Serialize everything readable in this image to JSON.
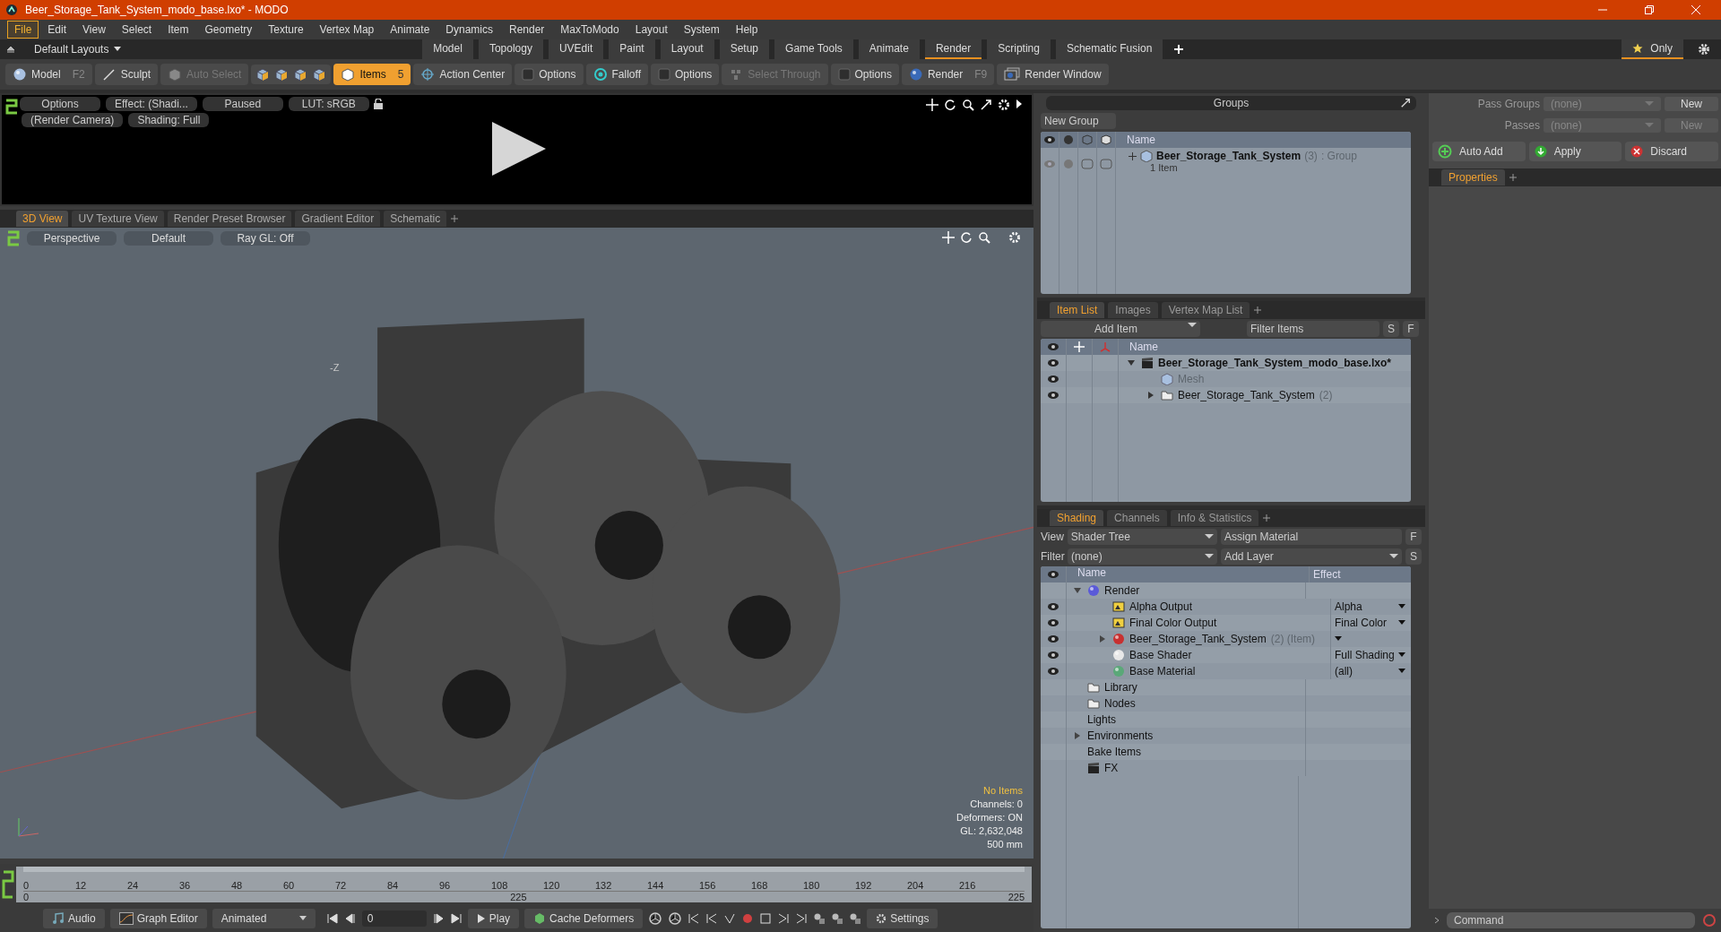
{
  "window": {
    "title": "Beer_Storage_Tank_System_modo_base.lxo* - MODO"
  },
  "menu": [
    {
      "label": "File",
      "selected": true
    },
    {
      "label": "Edit",
      "selected": false
    },
    {
      "label": "View",
      "selected": false
    },
    {
      "label": "Select",
      "selected": false
    },
    {
      "label": "Item",
      "selected": false
    },
    {
      "label": "Geometry",
      "selected": false
    },
    {
      "label": "Texture",
      "selected": false
    },
    {
      "label": "Vertex Map",
      "selected": false
    },
    {
      "label": "Animate",
      "selected": false
    },
    {
      "label": "Dynamics",
      "selected": false
    },
    {
      "label": "Render",
      "selected": false
    },
    {
      "label": "MaxToModo",
      "selected": false
    },
    {
      "label": "Layout",
      "selected": false
    },
    {
      "label": "System",
      "selected": false
    },
    {
      "label": "Help",
      "selected": false
    }
  ],
  "layout_bar": {
    "layouts": "Default Layouts",
    "tabs": [
      {
        "label": "Model",
        "selected": false
      },
      {
        "label": "Topology",
        "selected": false
      },
      {
        "label": "UVEdit",
        "selected": false
      },
      {
        "label": "Paint",
        "selected": false
      },
      {
        "label": "Layout",
        "selected": false
      },
      {
        "label": "Setup",
        "selected": false
      },
      {
        "label": "Game Tools",
        "selected": false
      },
      {
        "label": "Animate",
        "selected": false
      },
      {
        "label": "Render",
        "selected": true
      },
      {
        "label": "Scripting",
        "selected": false
      },
      {
        "label": "Schematic Fusion",
        "selected": false
      }
    ],
    "only": "Only"
  },
  "toolbar": [
    {
      "kind": "model",
      "label": "Model",
      "shortcut": "F2",
      "selected": false,
      "disabled": false
    },
    {
      "kind": "sculpt",
      "label": "Sculpt",
      "selected": false,
      "disabled": false
    },
    {
      "kind": "select",
      "label": "Auto Select",
      "selected": false,
      "disabled": true
    },
    {
      "kind": "cubes"
    },
    {
      "kind": "items",
      "label": "Items",
      "shortcut": "5",
      "selected": true,
      "disabled": false
    },
    {
      "kind": "center",
      "label": "Action Center",
      "selected": false,
      "disabled": false
    },
    {
      "kind": "check",
      "label": "Options",
      "selected": false,
      "disabled": false
    },
    {
      "kind": "falloff",
      "label": "Falloff",
      "selected": false,
      "disabled": false
    },
    {
      "kind": "check",
      "label": "Options",
      "selected": false,
      "disabled": false
    },
    {
      "kind": "through",
      "label": "Select Through",
      "selected": false,
      "disabled": true
    },
    {
      "kind": "check",
      "label": "Options",
      "selected": false,
      "disabled": false
    },
    {
      "kind": "render",
      "label": "Render",
      "shortcut": "F9",
      "selected": false,
      "disabled": false
    },
    {
      "kind": "window",
      "label": "Render Window",
      "selected": false,
      "disabled": false
    }
  ],
  "preview": {
    "row1": [
      "Options",
      "Effect: (Shadi...",
      "Paused",
      "LUT: sRGB"
    ],
    "row2": [
      "(Render Camera)",
      "Shading: Full"
    ]
  },
  "viewport": {
    "tabs": [
      {
        "label": "3D View",
        "selected": true
      },
      {
        "label": "UV Texture View",
        "selected": false
      },
      {
        "label": "Render Preset Browser",
        "selected": false
      },
      {
        "label": "Gradient Editor",
        "selected": false
      },
      {
        "label": "Schematic",
        "selected": false
      }
    ],
    "chips": [
      "Perspective",
      "Default",
      "Ray GL: Off"
    ],
    "axis_label": "-Z",
    "info": [
      "No Items",
      "Channels: 0",
      "Deformers: ON",
      "GL: 2,632,048",
      "500 mm"
    ],
    "scene": {
      "kind": "picture"
    }
  },
  "timeline": {
    "ticks": [
      "0",
      "12",
      "24",
      "36",
      "48",
      "60",
      "72",
      "84",
      "96",
      "108",
      "120",
      "132",
      "144",
      "156",
      "168",
      "180",
      "192",
      "204",
      "216"
    ],
    "start": "0",
    "middle": "225",
    "end": "225"
  },
  "bottom_bar": {
    "audio": "Audio",
    "graph_editor": "Graph Editor",
    "mode": "Animated",
    "frame": "0",
    "play": "Play",
    "cache": "Cache Deformers",
    "settings": "Settings"
  },
  "groups": {
    "title": "Groups",
    "new_group": "New Group",
    "column": "Name",
    "rows": [
      {
        "name": "Beer_Storage_Tank_System",
        "count": "(3)",
        "type": ": Group",
        "sub": "1 Item"
      }
    ]
  },
  "item_list": {
    "tabs": [
      {
        "label": "Item List",
        "selected": true
      },
      {
        "label": "Images",
        "selected": false
      },
      {
        "label": "Vertex Map List",
        "selected": false
      }
    ],
    "add_item": "Add Item",
    "filter": {
      "placeholder": "Filter Items"
    },
    "s": "S",
    "f": "F",
    "column": "Name",
    "tree": [
      {
        "kind": "scene",
        "name": "Beer_Storage_Tank_System_modo_base.lxo*",
        "visible": true,
        "expanded": true,
        "children": [
          {
            "kind": "mesh",
            "name": "Mesh",
            "visible": true,
            "disabled": true
          },
          {
            "kind": "folder",
            "name": "Beer_Storage_Tank_System",
            "count": "(2)",
            "visible": true,
            "expanded": false
          }
        ]
      }
    ]
  },
  "shading": {
    "tabs": [
      {
        "label": "Shading",
        "selected": true
      },
      {
        "label": "Channels",
        "selected": false
      },
      {
        "label": "Info & Statistics",
        "selected": false
      }
    ],
    "view_label": "View",
    "view": "Shader Tree",
    "assign": "Assign Material",
    "f": "F",
    "filter_label": "Filter",
    "filter": "(none)",
    "add_layer": "Add Layer",
    "s": "S",
    "columns": [
      "Name",
      "Effect"
    ],
    "tree": [
      {
        "kind": "render",
        "name": "Render",
        "visible": false,
        "expanded": true,
        "children": [
          {
            "kind": "output",
            "name": "Alpha Output",
            "effect": "Alpha",
            "visible": true
          },
          {
            "kind": "output",
            "name": "Final Color Output",
            "effect": "Final Color",
            "visible": true
          },
          {
            "kind": "itemmat",
            "name": "Beer_Storage_Tank_System",
            "count": "(2) (Item)",
            "visible": true,
            "expanded": false
          },
          {
            "kind": "shader",
            "name": "Base Shader",
            "effect": "Full Shading",
            "visible": true
          },
          {
            "kind": "material",
            "name": "Base Material",
            "effect": "(all)",
            "visible": true
          }
        ]
      },
      {
        "kind": "folder",
        "name": "Library",
        "visible": false
      },
      {
        "kind": "folder",
        "name": "Nodes",
        "visible": false
      },
      {
        "kind": "none",
        "name": "Lights",
        "visible": false
      },
      {
        "kind": "none",
        "name": "Environments",
        "visible": false,
        "expanded": false
      },
      {
        "kind": "none",
        "name": "Bake Items",
        "visible": false
      },
      {
        "kind": "clapper",
        "name": "FX",
        "visible": false
      }
    ]
  },
  "passes": {
    "pass_groups_label": "Pass Groups",
    "pass_groups": "(none)",
    "new": "New",
    "passes_label": "Passes",
    "passes": "(none)",
    "new2": "New",
    "new2_disabled": true,
    "auto_add": "Auto Add",
    "apply": "Apply",
    "discard": "Discard"
  },
  "properties": {
    "tabs": [
      {
        "label": "Properties",
        "selected": true
      }
    ]
  },
  "command": {
    "placeholder": "Command"
  }
}
